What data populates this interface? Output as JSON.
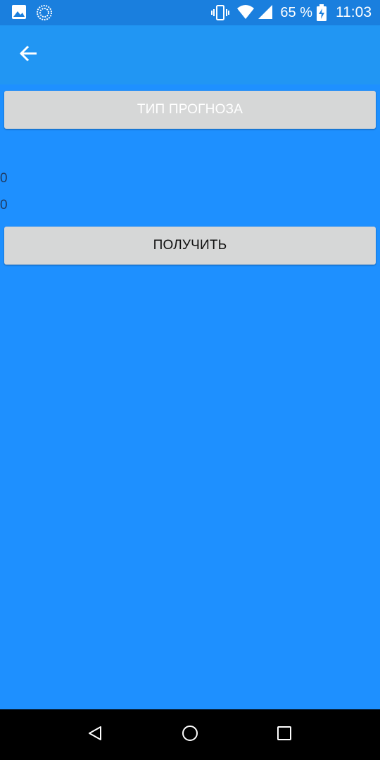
{
  "status_bar": {
    "battery_percent": "65 %",
    "time": "11:03",
    "icons": [
      "image-notification-icon",
      "sync-circle-icon",
      "vibrate-icon",
      "wifi-icon",
      "signal-icon",
      "battery-charging-icon"
    ]
  },
  "app_bar": {
    "back_icon": "arrow-back-icon",
    "color": "#2196f3"
  },
  "main": {
    "forecast_type_button_label": "ТИП ПРОГНОЗА",
    "value_1": "0",
    "value_2": "0",
    "get_button_label": "ПОЛУЧИТЬ",
    "background_color": "#1e90ff"
  },
  "nav_bar": {
    "icons": [
      "nav-back-icon",
      "nav-home-icon",
      "nav-recents-icon"
    ]
  }
}
